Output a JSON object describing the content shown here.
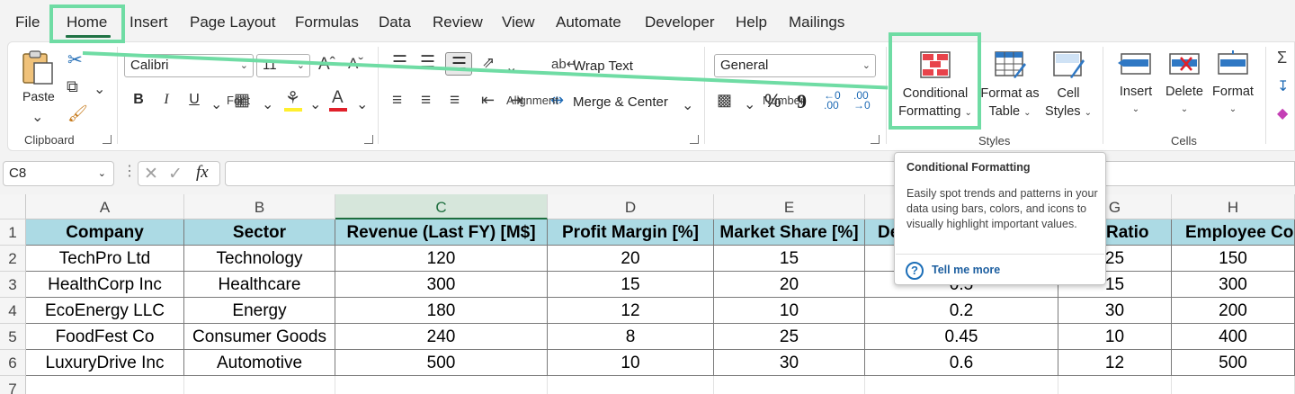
{
  "menu": {
    "tabs": [
      "File",
      "Home",
      "Insert",
      "Page Layout",
      "Formulas",
      "Data",
      "Review",
      "View",
      "Automate",
      "Developer",
      "Help",
      "Mailings"
    ],
    "active": "Home"
  },
  "ribbon": {
    "clipboard": {
      "paste_label": "Paste",
      "group_label": "Clipboard"
    },
    "font": {
      "font_name": "Calibri",
      "font_size": "11",
      "bold": "B",
      "italic": "I",
      "underline": "U",
      "group_label": "Font"
    },
    "alignment": {
      "wrap_text": "Wrap Text",
      "merge_center": "Merge & Center",
      "group_label": "Alignment"
    },
    "number": {
      "format": "General",
      "percent": "%",
      "comma": "9",
      "group_label": "Number"
    },
    "styles": {
      "conditional_formatting": [
        "Conditional",
        "Formatting"
      ],
      "format_as_table": [
        "Format as",
        "Table"
      ],
      "cell_styles": [
        "Cell",
        "Styles"
      ],
      "group_label": "Styles"
    },
    "cells": {
      "insert": "Insert",
      "delete": "Delete",
      "format": "Format",
      "group_label": "Cells"
    }
  },
  "formula_bar": {
    "name_box": "C8",
    "fx": "fx",
    "value": ""
  },
  "tooltip": {
    "title": "Conditional Formatting",
    "body": "Easily spot trends and patterns in your data using bars, colors, and icons to visually highlight important values.",
    "link": "Tell me more"
  },
  "sheet": {
    "columns": [
      "A",
      "B",
      "C",
      "D",
      "E",
      "F",
      "G",
      "H"
    ],
    "rows": [
      "1",
      "2",
      "3",
      "4",
      "5",
      "6",
      "7"
    ],
    "selected_column": "C",
    "header_color": "#acdae4",
    "headers": [
      "Company",
      "Sector",
      "Revenue (Last FY) [M$]",
      "Profit Margin [%]",
      "Market Share [%]",
      "De",
      "Ratio",
      "Employee Cou"
    ],
    "data": [
      [
        "TechPro Ltd",
        "Technology",
        "120",
        "20",
        "15",
        "",
        "25",
        "150"
      ],
      [
        "HealthCorp Inc",
        "Healthcare",
        "300",
        "15",
        "20",
        "0.5",
        "15",
        "300"
      ],
      [
        "EcoEnergy LLC",
        "Energy",
        "180",
        "12",
        "10",
        "0.2",
        "30",
        "200"
      ],
      [
        "FoodFest Co",
        "Consumer Goods",
        "240",
        "8",
        "25",
        "0.45",
        "10",
        "400"
      ],
      [
        "LuxuryDrive Inc",
        "Automotive",
        "500",
        "10",
        "30",
        "0.6",
        "12",
        "500"
      ]
    ]
  },
  "colors": {
    "accent": "#1f7244",
    "highlight": "#6fdca4",
    "link": "#1d5fa0"
  }
}
